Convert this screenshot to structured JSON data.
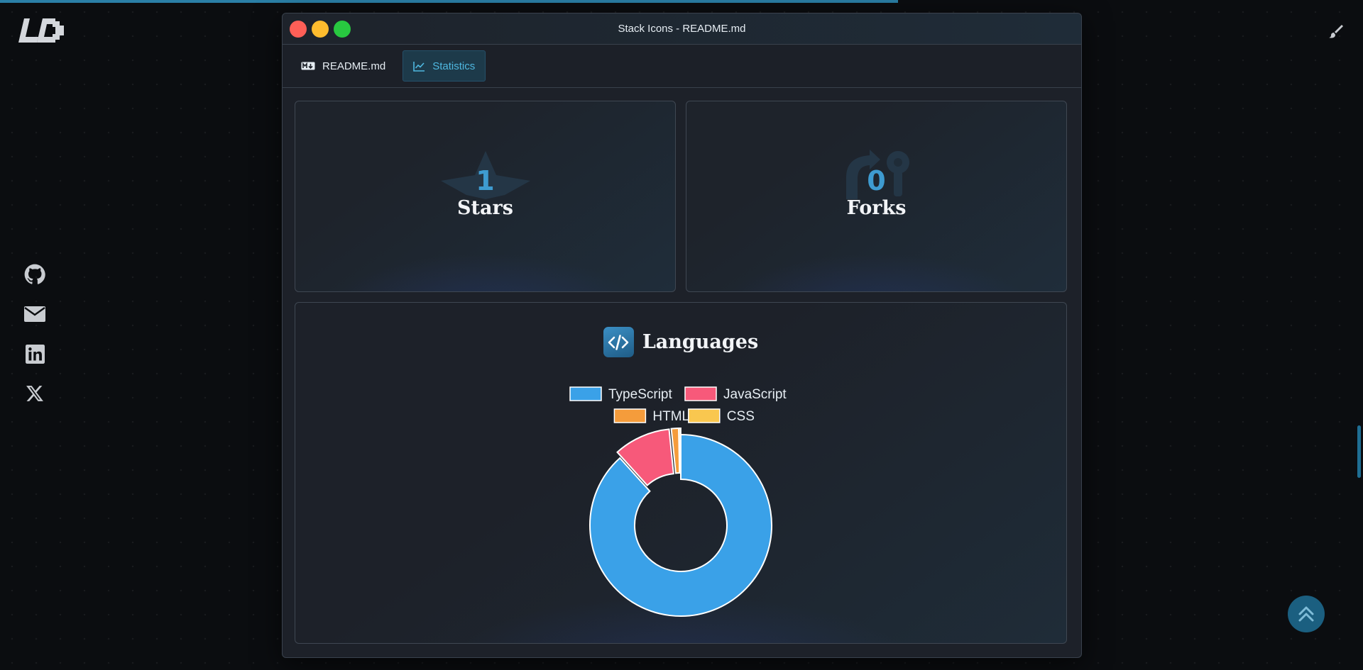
{
  "page": {
    "social_icons": [
      "github-icon",
      "email-icon",
      "linkedin-icon",
      "x-icon"
    ],
    "back_to_top_icon": "double-chevron-up-icon",
    "theme_icon": "paintbrush-icon"
  },
  "window": {
    "title": "Stack Icons - README.md",
    "tabs": [
      {
        "label": "README.md",
        "icon": "markdown-icon",
        "active": false
      },
      {
        "label": "Statistics",
        "icon": "line-chart-icon",
        "active": true
      }
    ]
  },
  "stats": {
    "stars": {
      "value": "1",
      "label": "Stars",
      "icon": "star-icon"
    },
    "forks": {
      "value": "0",
      "label": "Forks",
      "icon": "fork-icon"
    }
  },
  "languages": {
    "title": "Languages",
    "icon": "code-icon"
  },
  "chart_data": {
    "type": "pie",
    "variant": "doughnut",
    "title": "",
    "legend_position": "top",
    "categories": [
      "TypeScript",
      "JavaScript",
      "HTML",
      "CSS"
    ],
    "values": [
      88.3,
      10.1,
      1.3,
      0.3
    ],
    "colors": [
      "#3aa1e8",
      "#f7597a",
      "#f59c3b",
      "#f9c74f"
    ]
  }
}
